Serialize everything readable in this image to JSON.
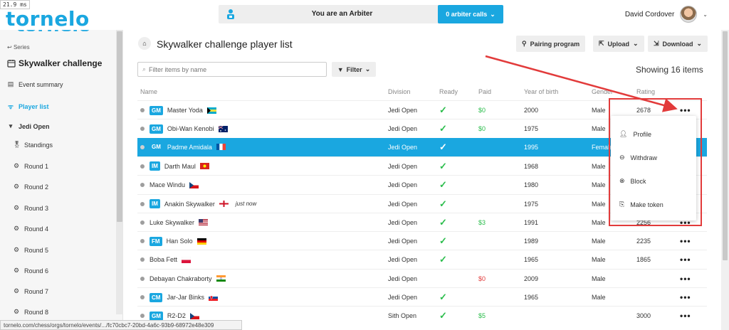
{
  "timing": "21.9 ms",
  "brand": {
    "logo": "tornelo",
    "logo_ghost": "tornelo",
    "color": "#1aa7e0"
  },
  "arbiter": {
    "text": "You are an Arbiter",
    "calls_label": "0 arbiter calls"
  },
  "user": {
    "name": "David Cordover"
  },
  "sidebar": {
    "back_label": "Series",
    "event_title": "Skywalker challenge",
    "items": [
      {
        "label": "Event summary",
        "icon": "document-icon"
      },
      {
        "label": "Player list",
        "icon": "players-icon",
        "active": true
      }
    ],
    "section": "Jedi Open",
    "sub_items": [
      "Standings",
      "Round 1",
      "Round 2",
      "Round 3",
      "Round 4",
      "Round 5",
      "Round 6",
      "Round 7",
      "Round 8"
    ]
  },
  "page": {
    "title": "Skywalker challenge player list",
    "pairing_label": "Pairing program",
    "upload_label": "Upload",
    "download_label": "Download",
    "filter_placeholder": "Filter items by name",
    "filter_button": "Filter",
    "showing": "Showing 16 items"
  },
  "columns": [
    "Name",
    "Division",
    "Ready",
    "Paid",
    "Year of birth",
    "Gender",
    "Rating"
  ],
  "rows": [
    {
      "title": "GM",
      "name": "Master Yoda",
      "flag": "bahamas",
      "note": "",
      "division": "Jedi Open",
      "ready": true,
      "paid": "$0",
      "paid_color": "green",
      "year": "2000",
      "gender": "Male",
      "rating": "2678"
    },
    {
      "title": "GM",
      "name": "Obi-Wan Kenobi",
      "flag": "australia",
      "note": "",
      "division": "Jedi Open",
      "ready": true,
      "paid": "$0",
      "paid_color": "green",
      "year": "1975",
      "gender": "Male",
      "rating": ""
    },
    {
      "title": "GM",
      "name": "Padme Amidala",
      "flag": "france",
      "note": "",
      "division": "Jedi Open",
      "ready": true,
      "paid": "",
      "paid_color": "",
      "year": "1995",
      "gender": "Female",
      "rating": "",
      "selected": true
    },
    {
      "title": "IM",
      "name": "Darth Maul",
      "flag": "vietnam",
      "note": "",
      "division": "Jedi Open",
      "ready": true,
      "paid": "",
      "paid_color": "",
      "year": "1968",
      "gender": "Male",
      "rating": ""
    },
    {
      "title": "",
      "name": "Mace Windu",
      "flag": "czech",
      "note": "",
      "division": "Jedi Open",
      "ready": true,
      "paid": "",
      "paid_color": "",
      "year": "1980",
      "gender": "Male",
      "rating": ""
    },
    {
      "title": "IM",
      "name": "Anakin Skywalker",
      "flag": "england",
      "note": "just now",
      "division": "Jedi Open",
      "ready": true,
      "paid": "",
      "paid_color": "",
      "year": "1975",
      "gender": "Male",
      "rating": ""
    },
    {
      "title": "",
      "name": "Luke Skywalker",
      "flag": "usa",
      "note": "",
      "division": "Jedi Open",
      "ready": true,
      "paid": "$3",
      "paid_color": "green",
      "year": "1991",
      "gender": "Male",
      "rating": "2256"
    },
    {
      "title": "FM",
      "name": "Han Solo",
      "flag": "germany",
      "note": "",
      "division": "Jedi Open",
      "ready": true,
      "paid": "",
      "paid_color": "",
      "year": "1989",
      "gender": "Male",
      "rating": "2235"
    },
    {
      "title": "",
      "name": "Boba Fett",
      "flag": "poland",
      "note": "",
      "division": "Jedi Open",
      "ready": true,
      "paid": "",
      "paid_color": "",
      "year": "1965",
      "gender": "Male",
      "rating": "1865"
    },
    {
      "title": "",
      "name": "Debayan Chakraborty",
      "flag": "india",
      "note": "",
      "division": "Jedi Open",
      "ready": false,
      "paid": "$0",
      "paid_color": "red",
      "year": "2009",
      "gender": "Male",
      "rating": ""
    },
    {
      "title": "CM",
      "name": "Jar-Jar Binks",
      "flag": "slovakia",
      "note": "",
      "division": "Jedi Open",
      "ready": true,
      "paid": "",
      "paid_color": "",
      "year": "1965",
      "gender": "Male",
      "rating": ""
    },
    {
      "title": "GM",
      "name": "R2-D2",
      "flag": "czech",
      "note": "",
      "division": "Sith Open",
      "ready": true,
      "paid": "$5",
      "paid_color": "green",
      "year": "",
      "gender": "",
      "rating": "3000"
    }
  ],
  "menu": {
    "items": [
      "Profile",
      "Withdraw",
      "Block",
      "Make token"
    ]
  },
  "status_url": "tornelo.com/chess/orgs/tornelo/events/.../fc70cbc7-20bd-4a6c-93b9-68972e48e309"
}
